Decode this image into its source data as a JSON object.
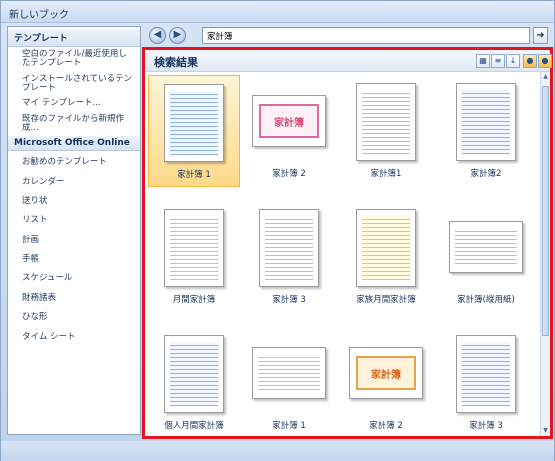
{
  "window": {
    "title": "新しいブック"
  },
  "sidebar": {
    "header": "テンプレート",
    "items": [
      {
        "label": "空白のファイル/最近使用したテンプレート"
      },
      {
        "label": "インストールされているテンプレート"
      },
      {
        "label": "マイ テンプレート..."
      },
      {
        "label": "既存のファイルから新規作成..."
      }
    ],
    "section_header": "Microsoft Office Online",
    "online_items": [
      {
        "label": "お勧めのテンプレート"
      },
      {
        "label": "カレンダー"
      },
      {
        "label": "送り状"
      },
      {
        "label": "リスト"
      },
      {
        "label": "計画"
      },
      {
        "label": "手帳"
      },
      {
        "label": "スケジュール"
      },
      {
        "label": "財務諸表"
      },
      {
        "label": "ひな形"
      },
      {
        "label": "タイム シート"
      }
    ]
  },
  "nav": {
    "search_value": "家計簿",
    "back_icon": "back-arrow-icon",
    "forward_icon": "forward-arrow-icon",
    "go_icon": "go-arrow-icon"
  },
  "results": {
    "title": "検索結果",
    "toolbar_icons": [
      "view-icon",
      "sort-icon",
      "sort-az-icon",
      "user-icon",
      "user-group-icon"
    ],
    "templates": [
      {
        "label": "家計簿 1",
        "cover": "",
        "selected": true
      },
      {
        "label": "家計簿 2",
        "cover": "家計簿"
      },
      {
        "label": "家計簿1",
        "cover": ""
      },
      {
        "label": "家計簿2",
        "cover": ""
      },
      {
        "label": "月間家計簿",
        "cover": ""
      },
      {
        "label": "家計簿 3",
        "cover": ""
      },
      {
        "label": "家族月間家計簿",
        "cover": ""
      },
      {
        "label": "家計簿(縦用紙)",
        "cover": ""
      },
      {
        "label": "個人月間家計簿",
        "cover": ""
      },
      {
        "label": "家計簿 1",
        "cover": ""
      },
      {
        "label": "家計簿 2",
        "cover": "家計簿"
      },
      {
        "label": "家計簿 3",
        "cover": ""
      }
    ]
  }
}
